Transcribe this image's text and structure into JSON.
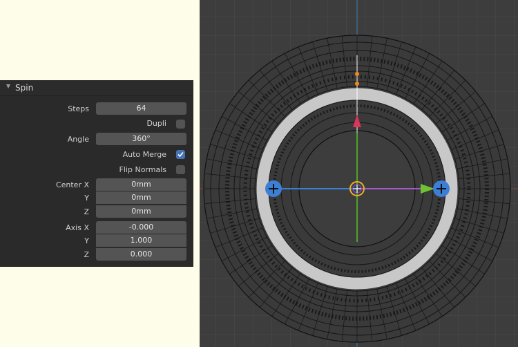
{
  "operator_panel": {
    "title": "Spin",
    "steps": {
      "label": "Steps",
      "value": "64"
    },
    "dupli": {
      "label": "Dupli",
      "checked": false
    },
    "angle": {
      "label": "Angle",
      "value": "360°"
    },
    "auto_merge": {
      "label": "Auto Merge",
      "checked": true
    },
    "flip_normals": {
      "label": "Flip Normals",
      "checked": false
    },
    "center": {
      "x": {
        "label": "Center X",
        "value": "0mm"
      },
      "y": {
        "label": "Y",
        "value": "0mm"
      },
      "z": {
        "label": "Z",
        "value": "0mm"
      }
    },
    "axis": {
      "x": {
        "label": "Axis X",
        "value": "-0.000"
      },
      "y": {
        "label": "Y",
        "value": "1.000"
      },
      "z": {
        "label": "Z",
        "value": "0.000"
      }
    }
  },
  "viewport": {
    "colors": {
      "background": "#3d3d3d",
      "grid": "#4a4a4a",
      "x_axis": "#a03a3a",
      "y_axis": "#3a7fb8",
      "wire": "#111111",
      "selected_ring": "#c8c8c8",
      "gizmo_blue": "#3b7fd6",
      "gizmo_red": "#e0335a",
      "gizmo_green": "#6ec234",
      "gizmo_orange": "#f08a1e",
      "axis_line_purple": "#a35ad0",
      "axis_line_green": "#4fa32a"
    },
    "icons": [
      "spin-gizmo-left-handle-icon",
      "spin-gizmo-right-handle-icon",
      "3d-cursor-icon",
      "spin-arrow-icon"
    ]
  }
}
